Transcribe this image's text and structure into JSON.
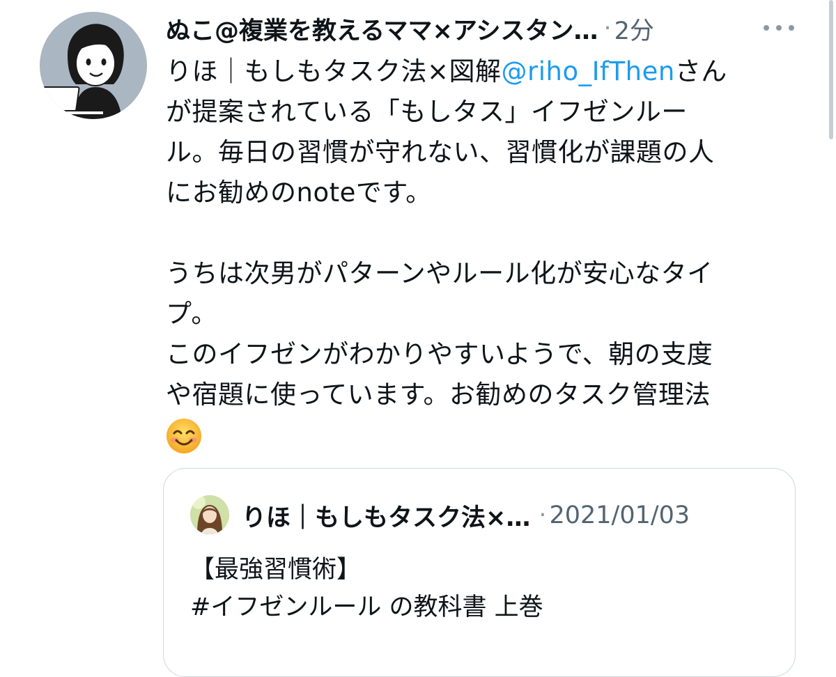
{
  "tweet": {
    "author_name": "ぬこ@複業を教えるママ×アシスタン…",
    "separator": "·",
    "time": "2分",
    "more_icon": "more-horizontal-icon",
    "lines": [
      {
        "pre": "りほ｜もしもタスク法×図解",
        "mention": "@riho_IfThen",
        "post": "さん"
      },
      "が提案されている「もしタス」イフゼンルー",
      "ル。毎日の習慣が守れない、習慣化が課題の人",
      "にお勧めのnoteです。",
      "",
      "うちは次男がパターンやルール化が安心なタイ",
      "プ。",
      "このイフゼンがわかりやすいようで、朝の支度",
      "や宿題に使っています。お勧めのタスク管理法"
    ],
    "emoji": "smiling-face-icon"
  },
  "quote": {
    "author_name": "りほ｜もしもタスク法×…",
    "separator": "·",
    "date": "2021/01/03",
    "lines": [
      "【最強習慣術】",
      "#イフゼンルール の教科書 上巻"
    ]
  },
  "colors": {
    "link": "#1d9bf0",
    "muted": "#536471",
    "border": "#cfd9de"
  }
}
